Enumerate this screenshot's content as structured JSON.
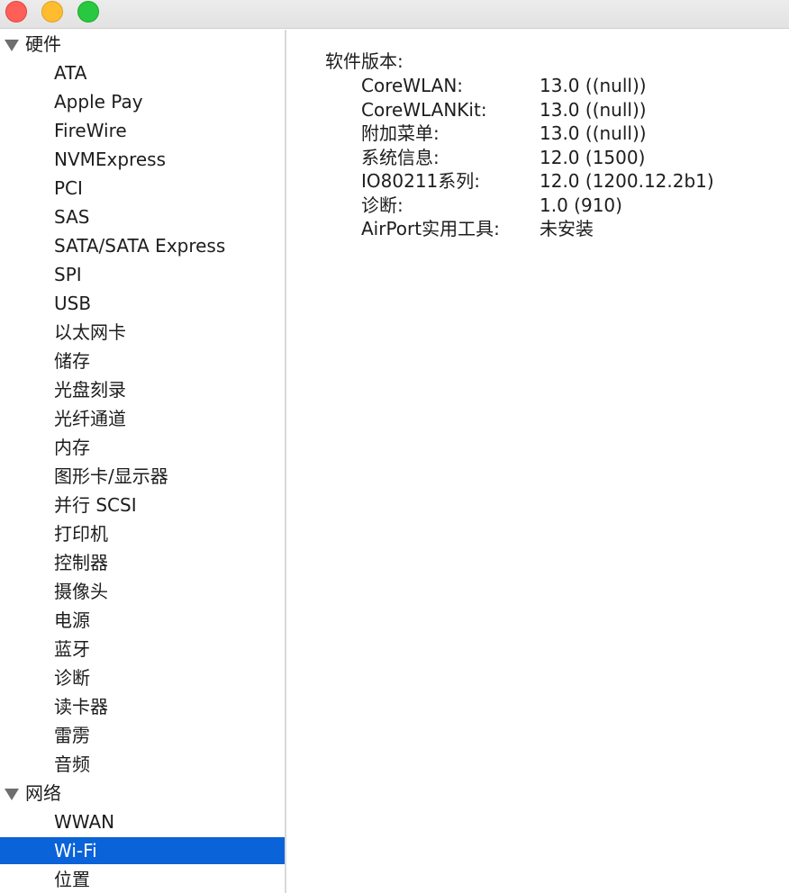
{
  "window": {
    "traffic_lights": {
      "close": "#fe5f57",
      "minimize": "#febc2e",
      "zoom": "#28c840"
    }
  },
  "sidebar": {
    "selection_color": "#0a63d8",
    "groups": [
      {
        "label": "硬件",
        "expanded": true,
        "items": [
          {
            "label": "ATA"
          },
          {
            "label": "Apple Pay"
          },
          {
            "label": "FireWire"
          },
          {
            "label": "NVMExpress"
          },
          {
            "label": "PCI"
          },
          {
            "label": "SAS"
          },
          {
            "label": "SATA/SATA Express"
          },
          {
            "label": "SPI"
          },
          {
            "label": "USB"
          },
          {
            "label": "以太网卡"
          },
          {
            "label": "储存"
          },
          {
            "label": "光盘刻录"
          },
          {
            "label": "光纤通道"
          },
          {
            "label": "内存"
          },
          {
            "label": "图形卡/显示器"
          },
          {
            "label": "并行 SCSI"
          },
          {
            "label": "打印机"
          },
          {
            "label": "控制器"
          },
          {
            "label": "摄像头"
          },
          {
            "label": "电源"
          },
          {
            "label": "蓝牙"
          },
          {
            "label": "诊断"
          },
          {
            "label": "读卡器"
          },
          {
            "label": "雷雳"
          },
          {
            "label": "音频"
          }
        ]
      },
      {
        "label": "网络",
        "expanded": true,
        "items": [
          {
            "label": "WWAN"
          },
          {
            "label": "Wi-Fi",
            "selected": true
          },
          {
            "label": "位置"
          }
        ]
      }
    ]
  },
  "detail": {
    "section_title": "软件版本:",
    "rows": [
      {
        "key": "CoreWLAN:",
        "value": "13.0 ((null))"
      },
      {
        "key": "CoreWLANKit:",
        "value": "13.0 ((null))"
      },
      {
        "key": "附加菜单:",
        "value": "13.0 ((null))"
      },
      {
        "key": "系统信息:",
        "value": "12.0 (1500)"
      },
      {
        "key": "IO80211系列:",
        "value": "12.0 (1200.12.2b1)"
      },
      {
        "key": "诊断:",
        "value": "1.0 (910)"
      },
      {
        "key": "AirPort实用工具:",
        "value": "未安装"
      }
    ]
  }
}
